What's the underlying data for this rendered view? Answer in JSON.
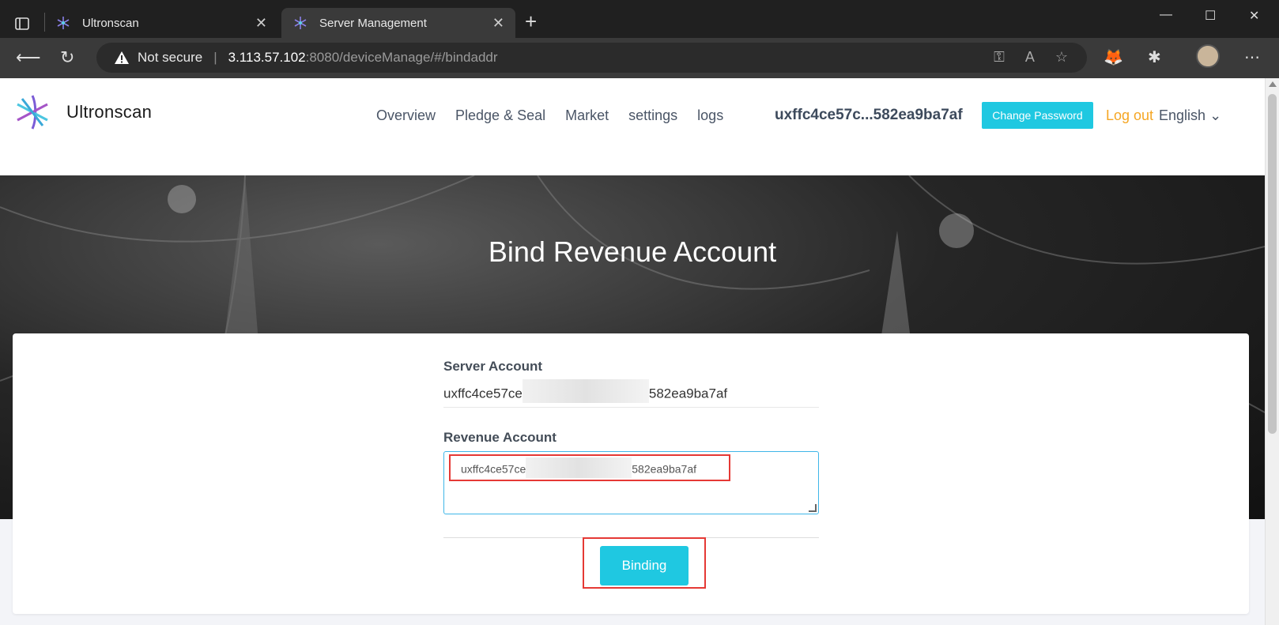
{
  "browser": {
    "tabs": [
      {
        "title": "Ultronscan",
        "active": false
      },
      {
        "title": "Server Management",
        "active": true
      }
    ],
    "address": {
      "security": "Not secure",
      "host": "3.113.57.102",
      "path": ":8080/deviceManage/#/bindaddr"
    },
    "icons": [
      "sidebar-icon",
      "back-icon",
      "reload-icon",
      "key-icon",
      "read-aloud-icon",
      "favorite-icon",
      "metamask-icon",
      "extensions-icon",
      "menu-icon"
    ]
  },
  "header": {
    "logo_text": "Ultronscan",
    "nav": [
      "Overview",
      "Pledge & Seal",
      "Market",
      "settings",
      "logs"
    ],
    "account": "uxffc4ce57c...582ea9ba7af",
    "change_password": "Change Password",
    "logout": "Log out",
    "language": "English",
    "colors": {
      "accent": "#1fc8e1",
      "logout": "#f5a623"
    }
  },
  "banner": {
    "title": "Bind Revenue Account"
  },
  "form": {
    "server_label": "Server Account",
    "server_prefix": "uxffc4ce57ce",
    "server_suffix": "582ea9ba7af",
    "revenue_label": "Revenue Account",
    "revenue_prefix": "uxffc4ce57ce",
    "revenue_suffix": "582ea9ba7af",
    "submit": "Binding"
  }
}
